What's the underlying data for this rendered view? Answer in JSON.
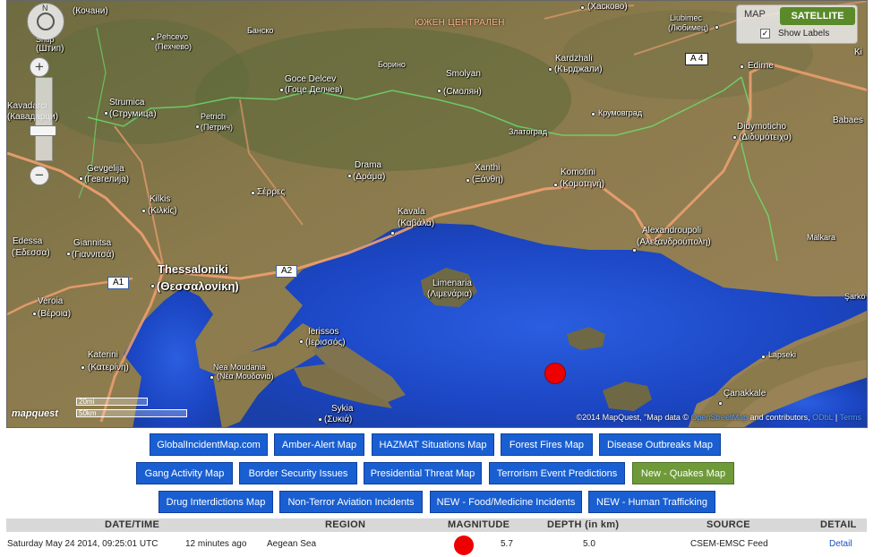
{
  "map": {
    "type_control": {
      "map_label": "MAP",
      "satellite_label": "SATELLITE",
      "show_labels": "Show Labels",
      "show_labels_checked": "✓"
    },
    "zoom": {
      "north": "N",
      "plus": "+",
      "minus": "−"
    },
    "scale": {
      "miles": "20mi",
      "km": "50km"
    },
    "logo": "mapquest",
    "attribution": {
      "prefix": "©2014 MapQuest, \"Map data ©",
      "osm": "OpenStreetMap",
      "middle": "and contributors,",
      "odbl": "ODbL",
      "sep": "|",
      "terms": "Terms"
    },
    "region_label": "ЮЖЕН ЦЕНТРАЛЕН",
    "road_shields": {
      "a1": "A1",
      "a2": "A2",
      "a4": "A 4"
    },
    "places": {
      "kochani": "(Кочани)",
      "shtip": "(Штип)",
      "shtip_lat": "Shtip",
      "pehchevo": "Pehcevo",
      "pehchevo_cyr": "(Пехчево)",
      "bansko": "Банско",
      "borino": "Борино",
      "krumovgrad": "Крумовград",
      "zlatograd": "Златоград",
      "haskovo": "(Хасково)",
      "liubimec": "Liubimec",
      "liubimec_cyr": "(Любимец)",
      "strumica": "Strumica",
      "strumica_cyr": "(Струмица)",
      "kavadarci": "Kavadarci",
      "kavadarci_cyr": "(Кавадарци)",
      "gotse": "Goce Delcev",
      "gotse_cyr": "(Гоце Делчев)",
      "smolyan": "Smolyan",
      "smolyan_cyr": "(Смолян)",
      "kardzhali": "Kardzhali",
      "kardzhali_cyr": "(Кърджали)",
      "edirne": "Edirne",
      "petrich": "Petrich",
      "petrich_cyr": "(Петрич)",
      "babaes": "Babaes",
      "didymoticho": "Didymoticho",
      "didymoticho_gr": "(Διδυμότειχο)",
      "gevgelija": "Gevgelija",
      "gevgelija_cyr": "(Гевгелија)",
      "drama": "Drama",
      "drama_gr": "(Δράμα)",
      "xanthi": "Xanthi",
      "xanthi_gr": "(Ξάνθη)",
      "komotini": "Komotini",
      "komotini_gr": "(Κομοτηνή)",
      "serres": "Σέρρες",
      "kilkis": "Kilkis",
      "kilkis_gr": "(Κιλκίς)",
      "kavala": "Kavala",
      "kavala_gr": "(Καβάλα)",
      "alexandroupoli": "Alexandroupoli",
      "alexandroupoli_gr": "(Αλεξανδρούπολη)",
      "edessa": "Edessa",
      "edessa_gr": "(Έδεσσα)",
      "giannitsa": "Giannitsa",
      "giannitsa_gr": "(Γιαννιτσά)",
      "malkara": "Malkara",
      "thessaloniki": "Thessaloniki",
      "thessaloniki_gr": "(Θεσσαλονίκη)",
      "limenaria": "Limenaria",
      "limenaria_gr": "(Λιμενάρια)",
      "sarkoy": "Şarkö",
      "veroia": "Veroia",
      "veroia_gr": "(Βέροια)",
      "ierissos": "Ierissos",
      "ierissos_gr": "(Ιερισσός)",
      "lapseki": "Lapseki",
      "katerini": "Katerini",
      "katerini_gr": "(Κατερίνη)",
      "moudania": "Nea Moudania",
      "moudania_gr": "(Νέα Μουδανιά)",
      "canakkale": "Çanakkale",
      "sykia": "Sykia",
      "sykia_gr": "(Συκιά)",
      "ki": "Ki"
    }
  },
  "nav": {
    "row1": [
      "GlobalIncidentMap.com",
      "Amber-Alert Map",
      "HAZMAT Situations Map",
      "Forest Fires Map",
      "Disease Outbreaks Map"
    ],
    "row2": [
      "Gang Activity Map",
      "Border Security Issues",
      "Presidential Threat Map",
      "Terrorism Event Predictions",
      "New - Quakes Map"
    ],
    "row3": [
      "Drug Interdictions Map",
      "Non-Terror Aviation Incidents",
      "NEW - Food/Medicine Incidents",
      "NEW - Human Trafficking"
    ]
  },
  "table": {
    "headers": [
      "DATE/TIME",
      "REGION",
      "MAGNITUDE",
      "DEPTH (in km)",
      "SOURCE",
      "DETAIL"
    ],
    "rows": [
      {
        "datetime": "Saturday May 24 2014, 09:25:01 UTC",
        "ago": "12 minutes ago",
        "region": "Aegean Sea",
        "magnitude": "5.7",
        "depth": "5.0",
        "source": "CSEM-EMSC Feed",
        "detail": "Detail"
      }
    ]
  },
  "colors": {
    "button_blue": "#1a5fd1",
    "button_green": "#6f9a3a",
    "quake_red": "#ee0000",
    "sea": "#1f4fc8"
  }
}
